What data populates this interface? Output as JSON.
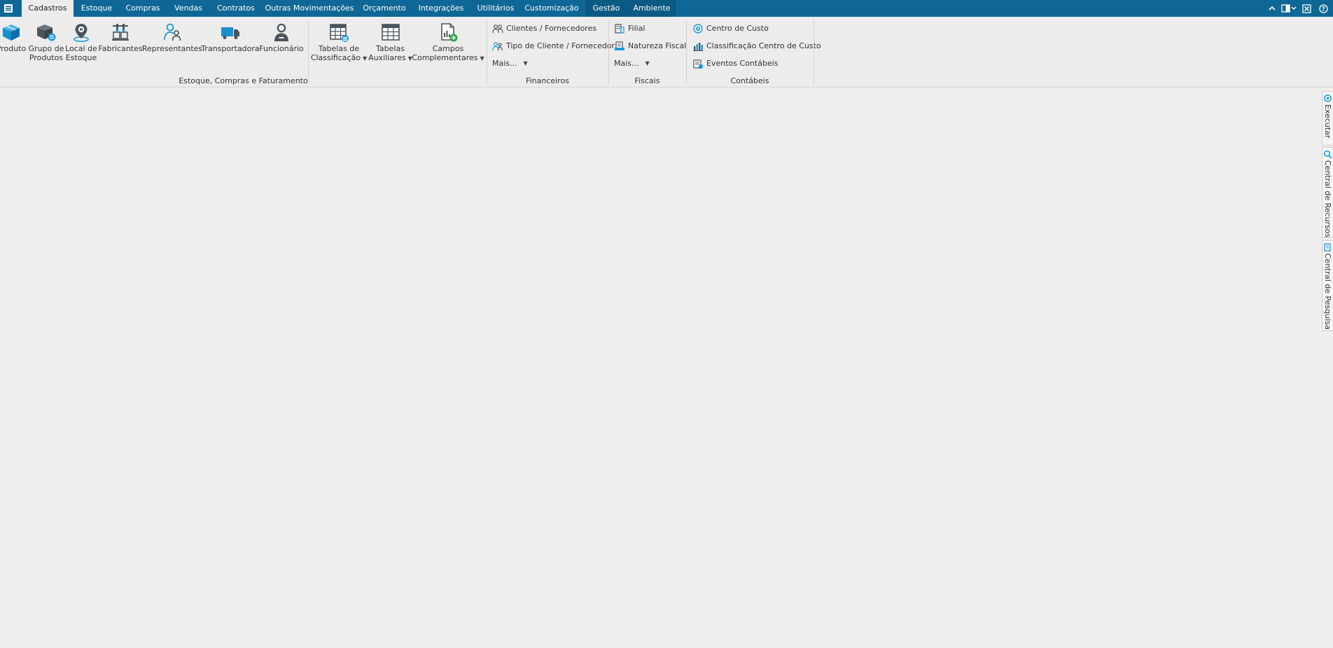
{
  "tabs": [
    {
      "label": "Cadastros"
    },
    {
      "label": "Estoque"
    },
    {
      "label": "Compras"
    },
    {
      "label": "Vendas"
    },
    {
      "label": "Contratos"
    },
    {
      "label": "Outras Movimentações"
    },
    {
      "label": "Orçamento"
    },
    {
      "label": "Integrações"
    },
    {
      "label": "Utilitários"
    },
    {
      "label": "Customização"
    },
    {
      "label": "Gestão"
    },
    {
      "label": "Ambiente"
    }
  ],
  "active_tab": "Cadastros",
  "colors": {
    "tabbar": "#0f6796",
    "accent": "#1a9ad6",
    "green": "#2aa84a"
  },
  "ribbon": {
    "estoque": {
      "label": "Estoque, Compras e Faturamento",
      "buttons": [
        {
          "line1": "Produto",
          "line2": "",
          "icon": "box-icon"
        },
        {
          "line1": "Grupo de",
          "line2": "Produtos",
          "icon": "box-group-icon"
        },
        {
          "line1": "Local de",
          "line2": "Estoque",
          "icon": "location-pin-icon"
        },
        {
          "line1": "Fabricantes",
          "line2": "",
          "icon": "factory-icon"
        },
        {
          "line1": "Representantes",
          "line2": "",
          "icon": "representative-icon"
        },
        {
          "line1": "Transportadora",
          "line2": "",
          "icon": "truck-icon"
        },
        {
          "line1": "Funcionário",
          "line2": "",
          "icon": "employee-icon"
        },
        {
          "line1": "Tabelas de",
          "line2": "Classificação",
          "icon": "table-list-icon"
        },
        {
          "line1": "Tabelas",
          "line2": "Auxiliares",
          "icon": "table-grid-icon"
        },
        {
          "line1": "Campos",
          "line2": "Complementares",
          "icon": "document-add-icon"
        }
      ]
    },
    "financeiros": {
      "label": "Financeiros",
      "items": [
        "Clientes / Fornecedores",
        "Tipo de Cliente / Fornecedor"
      ],
      "more": "Mais..."
    },
    "fiscais": {
      "label": "Fiscais",
      "items": [
        "Filial",
        "Natureza Fiscal"
      ],
      "more": "Mais..."
    },
    "contabeis": {
      "label": "Contábeis",
      "items": [
        "Centro de Custo",
        "Classificação Centro de Custo",
        "Eventos Contábeis"
      ]
    }
  },
  "side_tabs": [
    "Executar",
    "Central de Recursos",
    "Central de Pesquisa"
  ]
}
